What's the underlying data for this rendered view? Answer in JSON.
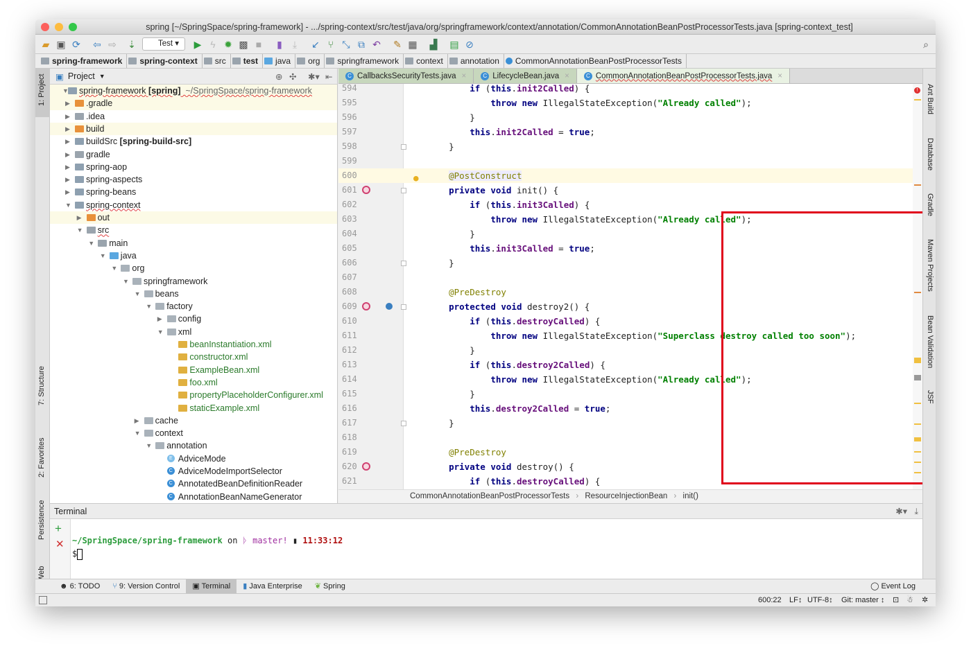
{
  "window": {
    "title": "spring [~/SpringSpace/spring-framework] - .../spring-context/src/test/java/org/springframework/context/annotation/CommonAnnotationBeanPostProcessorTests.java [spring-context_test]"
  },
  "toolbar": {
    "run_config": "Test"
  },
  "navbar": {
    "crumbs": [
      "spring-framework",
      "spring-context",
      "src",
      "test",
      "java",
      "org",
      "springframework",
      "context",
      "annotation",
      "CommonAnnotationBeanPostProcessorTests"
    ]
  },
  "left_strip": [
    "1: Project",
    "7: Structure",
    "2: Favorites",
    "Persistence",
    "Web"
  ],
  "right_strip": [
    "Ant Build",
    "Database",
    "Gradle",
    "Maven Projects",
    "Bean Validation",
    "JSF"
  ],
  "project": {
    "title": "Project",
    "tree": [
      {
        "level": 0,
        "label": "spring-framework",
        "bold": " [spring]",
        "extra": "  ~/SpringSpace/spring-framework",
        "icon": "module",
        "open": true,
        "hl": true
      },
      {
        "level": 1,
        "label": ".gradle",
        "icon": "orange",
        "open": false,
        "hl": true
      },
      {
        "level": 1,
        "label": ".idea",
        "icon": "folder",
        "open": false
      },
      {
        "level": 1,
        "label": "build",
        "icon": "orange",
        "open": false,
        "hl": true
      },
      {
        "level": 1,
        "label": "buildSrc",
        "bold": " [spring-build-src]",
        "icon": "module",
        "open": false
      },
      {
        "level": 1,
        "label": "gradle",
        "icon": "folder",
        "open": false
      },
      {
        "level": 1,
        "label": "spring-aop",
        "icon": "module",
        "open": false
      },
      {
        "level": 1,
        "label": "spring-aspects",
        "icon": "module",
        "open": false
      },
      {
        "level": 1,
        "label": "spring-beans",
        "icon": "module",
        "open": false
      },
      {
        "level": 1,
        "label": "spring-context",
        "icon": "module",
        "open": true
      },
      {
        "level": 2,
        "label": "out",
        "icon": "orange",
        "open": false,
        "hl": true
      },
      {
        "level": 2,
        "label": "src",
        "icon": "folder",
        "open": true
      },
      {
        "level": 3,
        "label": "main",
        "icon": "folder",
        "open": true
      },
      {
        "level": 4,
        "label": "java",
        "icon": "blue",
        "open": true
      },
      {
        "level": 5,
        "label": "org",
        "icon": "package",
        "open": true
      },
      {
        "level": 6,
        "label": "springframework",
        "icon": "package",
        "open": true
      },
      {
        "level": 7,
        "label": "beans",
        "icon": "package",
        "open": true
      },
      {
        "level": 8,
        "label": "factory",
        "icon": "package",
        "open": true
      },
      {
        "level": 9,
        "label": "config",
        "icon": "package",
        "open": false
      },
      {
        "level": 9,
        "label": "xml",
        "icon": "package",
        "open": true
      },
      {
        "level": 10,
        "label": "beanInstantiation.xml",
        "icon": "xml",
        "file": true
      },
      {
        "level": 10,
        "label": "constructor.xml",
        "icon": "xml",
        "file": true
      },
      {
        "level": 10,
        "label": "ExampleBean.xml",
        "icon": "xml",
        "file": true
      },
      {
        "level": 10,
        "label": "foo.xml",
        "icon": "xml",
        "file": true
      },
      {
        "level": 10,
        "label": "propertyPlaceholderConfigurer.xml",
        "icon": "xml",
        "file": true
      },
      {
        "level": 10,
        "label": "staticExample.xml",
        "icon": "xml",
        "file": true
      },
      {
        "level": 7,
        "label": "cache",
        "icon": "package",
        "open": false
      },
      {
        "level": 7,
        "label": "context",
        "icon": "package",
        "open": true
      },
      {
        "level": 8,
        "label": "annotation",
        "icon": "package",
        "open": true
      },
      {
        "level": 9,
        "label": "AdviceMode",
        "icon": "enum",
        "leaf": true
      },
      {
        "level": 9,
        "label": "AdviceModeImportSelector",
        "icon": "class",
        "leaf": true
      },
      {
        "level": 9,
        "label": "AnnotatedBeanDefinitionReader",
        "icon": "class",
        "leaf": true
      },
      {
        "level": 9,
        "label": "AnnotationBeanNameGenerator",
        "icon": "class",
        "leaf": true
      }
    ]
  },
  "editor": {
    "tabs": [
      {
        "label": "CallbacksSecurityTests.java"
      },
      {
        "label": "LifecycleBean.java"
      },
      {
        "label": "CommonAnnotationBeanPostProcessorTests.java",
        "active": true
      }
    ],
    "first_line": 594,
    "current_line": 600,
    "lines": [
      "        if (this.init2Called) {",
      "            throw new IllegalStateException(\"Already called\");",
      "        }",
      "        this.init2Called = true;",
      "    }",
      "",
      "    @PostConstruct",
      "    private void init() {",
      "        if (this.init3Called) {",
      "            throw new IllegalStateException(\"Already called\");",
      "        }",
      "        this.init3Called = true;",
      "    }",
      "",
      "    @PreDestroy",
      "    protected void destroy2() {",
      "        if (this.destroyCalled) {",
      "            throw new IllegalStateException(\"Superclass destroy called too soon\");",
      "        }",
      "        if (this.destroy2Called) {",
      "            throw new IllegalStateException(\"Already called\");",
      "        }",
      "        this.destroy2Called = true;",
      "    }",
      "",
      "    @PreDestroy",
      "    private void destroy() {",
      "        if (this.destroyCalled) {"
    ],
    "breadcrumb": [
      "CommonAnnotationBeanPostProcessorTests",
      "ResourceInjectionBean",
      "init()"
    ]
  },
  "terminal": {
    "title": "Terminal",
    "path": "~/SpringSpace/spring-framework",
    "on": " on ",
    "branch_icon": "ᚦ",
    "branch": "master!",
    "time": "11:33:12",
    "prompt": "$"
  },
  "bottom_tabs": [
    "6: TODO",
    "9: Version Control",
    "Terminal",
    "Java Enterprise",
    "Spring"
  ],
  "event_log": "Event Log",
  "status": {
    "position": "600:22",
    "line_sep": "LF↕",
    "encoding": "UTF-8↕",
    "git": "Git: master ↕"
  },
  "colors": {
    "highlight_box": "#e0001b",
    "keyword": "#000080",
    "field": "#660e7a",
    "string": "#008000",
    "annotation": "#808000"
  }
}
